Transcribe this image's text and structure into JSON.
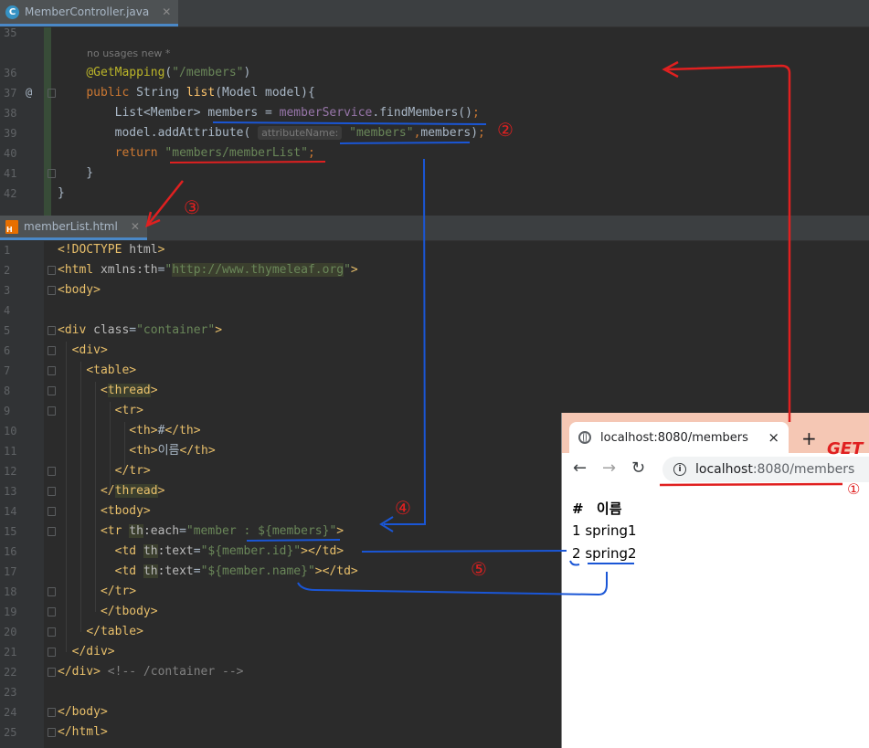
{
  "editor1": {
    "tab_label": "MemberController.java",
    "tab_icon": "java-class-icon",
    "hint_usages": "no usages   new *",
    "lines": [
      {
        "n": "35",
        "html": ""
      },
      {
        "n": "36",
        "html": "    <span class=\"ann\">@GetMapping</span>(<span class=\"str\">\"/members\"</span>)"
      },
      {
        "n": "37",
        "html": "    <span class=\"kw\">public </span>String <span class=\"fn\">list</span>(Model model){"
      },
      {
        "n": "38",
        "html": "        List&lt;Member&gt; members = <span class=\"field\">memberService</span>.findMembers()<span class=\"kw\">;</span>"
      },
      {
        "n": "39",
        "html": "        model.addAttribute( <span class=\"hintbox\">attributeName:</span> <span class=\"str\">\"members\"</span><span class=\"kw\">,</span>members)<span class=\"kw\">;</span>"
      },
      {
        "n": "40",
        "html": "        <span class=\"kw\">return </span><span class=\"str\">\"members/memberList\"</span><span class=\"kw\">;</span>"
      },
      {
        "n": "41",
        "html": "    }"
      },
      {
        "n": "42",
        "html": "}"
      }
    ]
  },
  "editor2": {
    "tab_label": "memberList.html",
    "tab_icon": "html-file-icon",
    "lines": [
      {
        "n": "1",
        "html": "<span class=\"tag\">&lt;!DOCTYPE </span><span class=\"attr\">html</span><span class=\"tag\">&gt;</span>"
      },
      {
        "n": "2",
        "html": "<span class=\"tag\">&lt;html </span><span class=\"attr\">xmlns:th</span>=<span class=\"str\">\"<span class=\"hl\">http://www.thymeleaf.org</span>\"</span><span class=\"tag\">&gt;</span>"
      },
      {
        "n": "3",
        "html": "<span class=\"tag\">&lt;body&gt;</span>"
      },
      {
        "n": "4",
        "html": ""
      },
      {
        "n": "5",
        "html": "<span class=\"tag\">&lt;div </span><span class=\"attr\">class</span>=<span class=\"str\">\"container\"</span><span class=\"tag\">&gt;</span>"
      },
      {
        "n": "6",
        "html": "  <span class=\"tag\">&lt;div&gt;</span>"
      },
      {
        "n": "7",
        "html": "    <span class=\"tag\">&lt;table&gt;</span>"
      },
      {
        "n": "8",
        "html": "      <span class=\"tag\">&lt;<span class=\"hl\">thread</span>&gt;</span>"
      },
      {
        "n": "9",
        "html": "        <span class=\"tag\">&lt;tr&gt;</span>"
      },
      {
        "n": "10",
        "html": "          <span class=\"tag\">&lt;th&gt;</span>#<span class=\"tag\">&lt;/th&gt;</span>"
      },
      {
        "n": "11",
        "html": "          <span class=\"tag\">&lt;th&gt;</span>이름<span class=\"tag\">&lt;/th&gt;</span>"
      },
      {
        "n": "12",
        "html": "        <span class=\"tag\">&lt;/tr&gt;</span>"
      },
      {
        "n": "13",
        "html": "      <span class=\"tag\">&lt;/<span class=\"hl\">thread</span>&gt;</span>"
      },
      {
        "n": "14",
        "html": "      <span class=\"tag\">&lt;tbody&gt;</span>"
      },
      {
        "n": "15",
        "html": "      <span class=\"tag\">&lt;tr </span><span class=\"attr hl\">th</span><span class=\"attr\">:each</span>=<span class=\"str\">\"member : ${members}\"</span><span class=\"tag\">&gt;</span>"
      },
      {
        "n": "16",
        "html": "        <span class=\"tag\">&lt;td </span><span class=\"attr hl\">th</span><span class=\"attr\">:text</span>=<span class=\"str\">\"${member.id}\"</span><span class=\"tag\">&gt;&lt;/td&gt;</span>"
      },
      {
        "n": "17",
        "html": "        <span class=\"tag\">&lt;td </span><span class=\"attr hl\">th</span><span class=\"attr\">:text</span>=<span class=\"str\">\"${member.name}\"</span><span class=\"tag\">&gt;&lt;/td&gt;</span>"
      },
      {
        "n": "18",
        "html": "      <span class=\"tag\">&lt;/tr&gt;</span>"
      },
      {
        "n": "19",
        "html": "      <span class=\"tag\">&lt;/tbody&gt;</span>"
      },
      {
        "n": "20",
        "html": "    <span class=\"tag\">&lt;/table&gt;</span>"
      },
      {
        "n": "21",
        "html": "  <span class=\"tag\">&lt;/div&gt;</span>"
      },
      {
        "n": "22",
        "html": "<span class=\"tag\">&lt;/div&gt;</span> <span class=\"cm\">&lt;!-- /container --&gt;</span>"
      },
      {
        "n": "23",
        "html": ""
      },
      {
        "n": "24",
        "html": "<span class=\"tag\">&lt;/body&gt;</span>"
      },
      {
        "n": "25",
        "html": "<span class=\"tag\">&lt;/html&gt;</span>"
      }
    ]
  },
  "browser": {
    "tab_title": "localhost:8080/members",
    "tab_close": "×",
    "new_tab": "+",
    "back": "←",
    "forward": "→",
    "reload": "↻",
    "url_domain": "localhost",
    "url_path": ":8080/members",
    "table_header": [
      "#",
      "이름"
    ],
    "rows": [
      {
        "id": "1",
        "name": "spring1"
      },
      {
        "id": "2",
        "name": "spring2"
      }
    ]
  },
  "annotations": {
    "get_label": "GET",
    "step1": "①",
    "step2": "②",
    "step3": "③",
    "step4": "④",
    "step5": "⑤",
    "red": "#e02020",
    "blue": "#1a56d6"
  }
}
